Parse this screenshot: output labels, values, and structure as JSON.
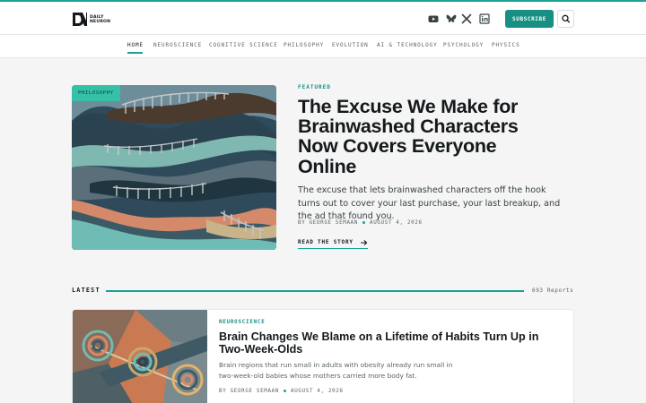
{
  "brand": {
    "line1": "DAILY",
    "line2": "NEURON"
  },
  "header": {
    "social_icons": [
      "youtube-icon",
      "bluesky-icon",
      "x-icon",
      "linkedin-icon"
    ],
    "subscribe_label": "SUBSCRIBE"
  },
  "nav": {
    "items": [
      {
        "label": "HOME",
        "active": true
      },
      {
        "label": "NEUROSCIENCE"
      },
      {
        "label": "COGNITIVE SCIENCE"
      },
      {
        "label": "PHILOSOPHY"
      },
      {
        "label": "EVOLUTION"
      },
      {
        "label": "AI & TECHNOLOGY"
      },
      {
        "label": "PSYCHOLOGY"
      },
      {
        "label": "PHYSICS"
      }
    ]
  },
  "featured": {
    "label": "FEATURED",
    "category": "PHILOSOPHY",
    "title": "The Excuse We Make for Brainwashed Characters Now Covers Everyone Online",
    "dek": "The excuse that lets brainwashed characters off the hook turns out to cover your last purchase, your last breakup, and the ad that found you.",
    "author": "BY GEORGE SEMAAN",
    "date": "AUGUST 4, 2026",
    "cta": "READ THE STORY"
  },
  "latest": {
    "label": "LATEST",
    "count": "693 Reports",
    "articles": [
      {
        "category": "NEUROSCIENCE",
        "title": "Brain Changes We Blame on a Lifetime of Habits Turn Up in Two-Week-Olds",
        "dek": "Brain regions that run small in adults with obesity already run small in two-week-old babies whose mothers carried more body fat.",
        "author": "BY GEORGE SEMAAN",
        "date": "AUGUST 4, 2026"
      }
    ]
  },
  "colors": {
    "accent": "#1aa394",
    "accent_dark": "#178f83",
    "text": "#15191c",
    "muted": "#5c6468",
    "background": "#f4f5f4"
  }
}
